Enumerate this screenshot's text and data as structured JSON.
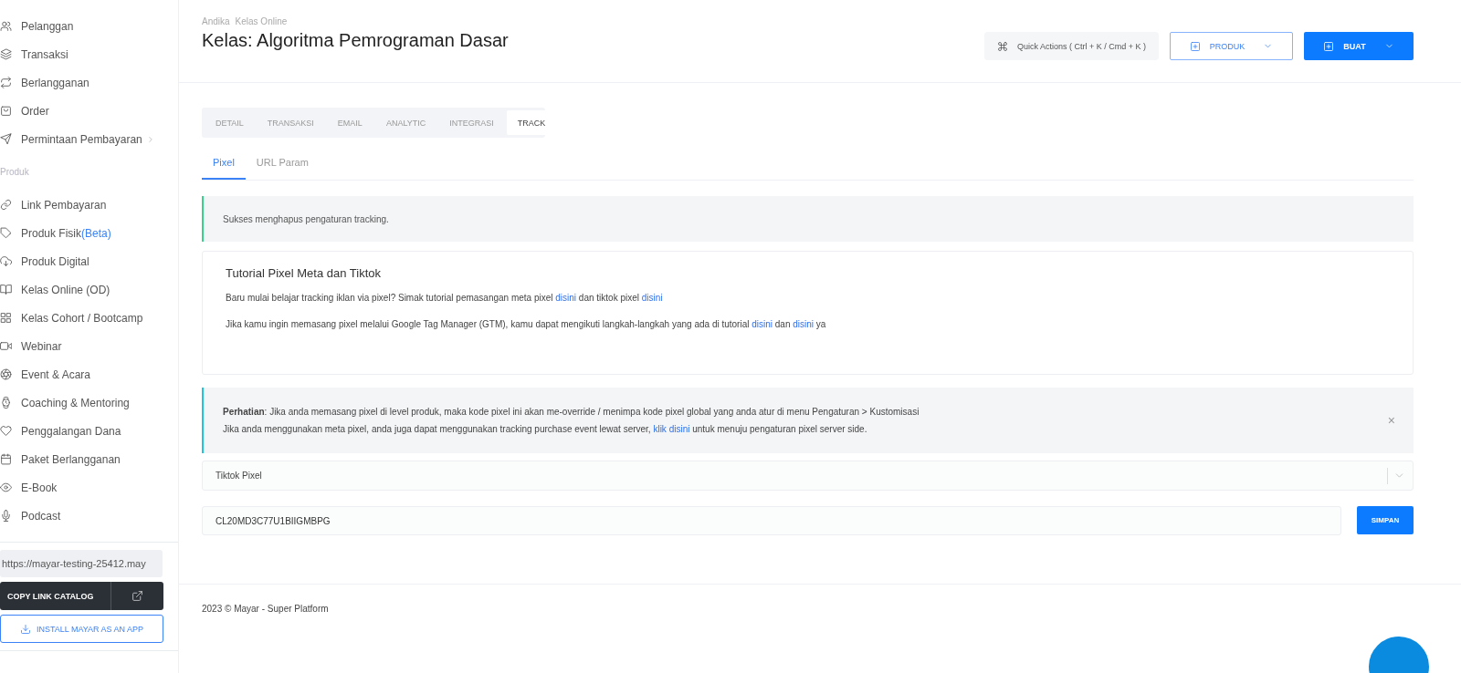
{
  "sidebar": {
    "items": [
      {
        "label": "Pelanggan",
        "selected": false
      },
      {
        "label": "Transaksi",
        "selected": false
      },
      {
        "label": "Berlangganan",
        "selected": false
      },
      {
        "label": "Order",
        "selected": false
      },
      {
        "label": "Permintaan Pembayaran",
        "selected": false,
        "has_submenu": true
      }
    ],
    "section": "Produk",
    "product_items": [
      {
        "label": "Link Pembayaran",
        "selected": false
      },
      {
        "label": "Produk Fisik",
        "tag": "(Beta)",
        "selected": false
      },
      {
        "label": "Produk Digital",
        "selected": false
      },
      {
        "label": "Kelas Online (OD)",
        "selected": false
      },
      {
        "label": "Kelas Cohort / Bootcamp",
        "selected": false
      },
      {
        "label": "Webinar",
        "selected": false
      },
      {
        "label": "Event & Acara",
        "selected": false
      },
      {
        "label": "Coaching & Mentoring",
        "selected": false
      },
      {
        "label": "Penggalangan Dana",
        "selected": false
      },
      {
        "label": "Paket Berlangganan",
        "selected": false
      },
      {
        "label": "E-Book",
        "selected": false
      },
      {
        "label": "Podcast",
        "selected": false
      }
    ],
    "catalog_url": "https://mayar-testing-25412.may",
    "copy_button": "COPY LINK CATALOG",
    "install_button": "INSTALL MAYAR AS AN APP"
  },
  "header": {
    "breadcrumb": [
      "Andika",
      "Kelas Online"
    ],
    "title": "Kelas: Algoritma Pemrograman Dasar",
    "quick_actions": "Quick Actions ( Ctrl + K / Cmd + K )",
    "produk_button": "PRODUK",
    "buat_button": "BUAT"
  },
  "tabs": [
    {
      "label": "DETAIL",
      "selected": false
    },
    {
      "label": "TRANSAKSI",
      "selected": false
    },
    {
      "label": "EMAIL",
      "selected": false
    },
    {
      "label": "ANALYTIC",
      "selected": false
    },
    {
      "label": "INTEGRASI",
      "selected": false
    },
    {
      "label": "TRACK",
      "selected": true
    }
  ],
  "subtabs": [
    {
      "label": "Pixel",
      "selected": true
    },
    {
      "label": "URL Param",
      "selected": false
    }
  ],
  "success_alert": "Sukses menghapus pengaturan tracking.",
  "tutorial": {
    "title": "Tutorial Pixel Meta dan Tiktok",
    "paragraphs": [
      [
        {
          "text": "Baru mulai belajar tracking iklan via pixel? Simak tutorial pemasangan meta pixel ",
          "link": false
        },
        {
          "text": "disini",
          "link": true
        },
        {
          "text": " dan tiktok pixel ",
          "link": false
        },
        {
          "text": "disini",
          "link": true
        }
      ],
      [
        {
          "text": "Jika kamu ingin memasang pixel melalui Google Tag Manager (GTM), kamu dapat mengikuti langkah-langkah yang ada di tutorial ",
          "link": false
        },
        {
          "text": "disini",
          "link": true
        },
        {
          "text": " dan ",
          "link": false
        },
        {
          "text": "disini",
          "link": true
        },
        {
          "text": " ya",
          "link": false
        }
      ]
    ]
  },
  "notice": {
    "line_1": "**Perhatian**: Jika anda memasang pixel di level produk, maka kode pixel ini akan me-override / menimpa kode pixel global yang anda atur di menu Pengaturan > Kustomisasi",
    "line_2": [
      {
        "text": "Jika anda menggunakan meta pixel, anda juga dapat menggunakan tracking purchase event lewat server, ",
        "link": false
      },
      {
        "text": "klik disini",
        "link": true
      },
      {
        "text": " untuk menuju pengaturan pixel server side.",
        "link": false
      }
    ],
    "close": "×"
  },
  "pixel_select": "Tiktok Pixel",
  "pixel_id": "CL20MD3C77U1BIIGMBPG",
  "save_button": "SIMPAN",
  "footer": "2023 © Mayar - Super Platform"
}
